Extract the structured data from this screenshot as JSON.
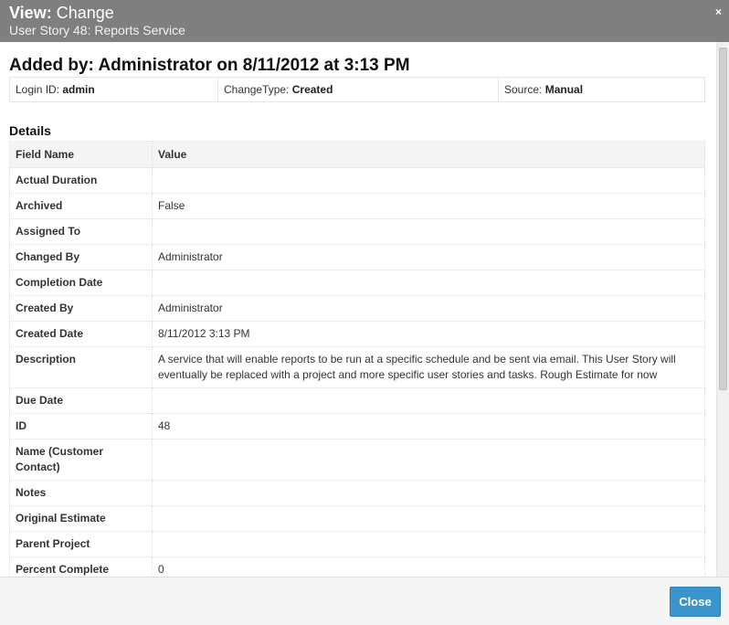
{
  "dialog": {
    "title_prefix": "View:",
    "title_main": "Change",
    "subtitle": "User Story 48: Reports Service",
    "close_icon": "×"
  },
  "header": {
    "added_by": "Added by: Administrator on 8/11/2012 at 3:13 PM"
  },
  "info": {
    "login_label": "Login ID:",
    "login_value": "admin",
    "changetype_label": "ChangeType:",
    "changetype_value": "Created",
    "source_label": "Source:",
    "source_value": "Manual"
  },
  "details": {
    "heading": "Details",
    "columns": [
      "Field Name",
      "Value"
    ],
    "rows": [
      {
        "field": "Actual Duration",
        "value": ""
      },
      {
        "field": "Archived",
        "value": "False"
      },
      {
        "field": "Assigned To",
        "value": ""
      },
      {
        "field": "Changed By",
        "value": "Administrator"
      },
      {
        "field": "Completion Date",
        "value": ""
      },
      {
        "field": "Created By",
        "value": "Administrator"
      },
      {
        "field": "Created Date",
        "value": "8/11/2012 3:13 PM"
      },
      {
        "field": "Description",
        "value": "A service that will enable reports to be run at a specific schedule and be sent via email. This User Story will eventually be replaced with a project and more specific user stories and tasks. Rough Estimate for now"
      },
      {
        "field": "Due Date",
        "value": ""
      },
      {
        "field": "ID",
        "value": "48"
      },
      {
        "field": "Name (Customer Contact)",
        "value": ""
      },
      {
        "field": "Notes",
        "value": ""
      },
      {
        "field": "Original Estimate",
        "value": ""
      },
      {
        "field": "Parent Project",
        "value": ""
      },
      {
        "field": "Percent Complete",
        "value": "0"
      }
    ]
  },
  "footer": {
    "close_label": "Close"
  },
  "colors": {
    "titlebar": "#7f7f7f",
    "accent_button": "#3a95cf"
  }
}
